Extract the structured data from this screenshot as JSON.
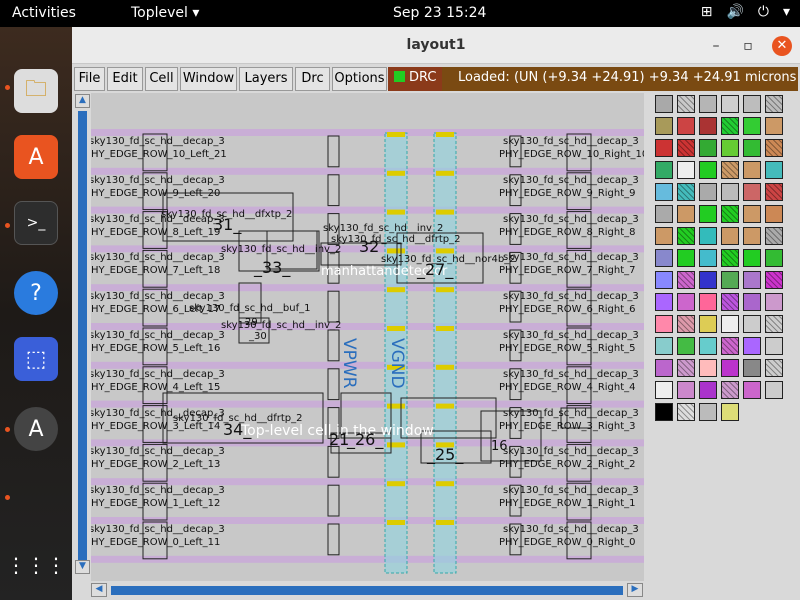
{
  "topbar": {
    "activities": "Activities",
    "app_menu": "Toplevel",
    "clock": "Sep 23  15:24",
    "tray": [
      "network-icon",
      "volume-icon",
      "power-icon",
      "chevron-down-icon"
    ]
  },
  "dock": {
    "apps": [
      {
        "name": "files-icon"
      },
      {
        "name": "software-store-icon"
      },
      {
        "name": "terminal-icon"
      },
      {
        "name": "help-icon"
      },
      {
        "name": "screenshot-icon"
      },
      {
        "name": "updater-icon"
      },
      {
        "name": "show-apps-icon"
      }
    ]
  },
  "window": {
    "title": "layout1",
    "minimize": "–",
    "maximize": "▫",
    "close": "✕"
  },
  "menu": {
    "items": [
      "File",
      "Edit",
      "Cell",
      "Window",
      "Layers",
      "Drc",
      "Options"
    ],
    "drc_label": "DRC",
    "status": "Loaded: (UN     (+9.34 +24.91) +9.34 +24.91 microns"
  },
  "canvas": {
    "rows_left": [
      {
        "cell": "sky130_fd_sc_hd__decap_3",
        "edge": "PHY_EDGE_ROW_10_Left_21"
      },
      {
        "cell": "sky130_fd_sc_hd__decap_3",
        "edge": "PHY_EDGE_ROW_9_Left_20"
      },
      {
        "cell": "sky130_fd_sc_hd__decap_3",
        "edge": "PHY_EDGE_ROW_8_Left_19"
      },
      {
        "cell": "sky130_fd_sc_hd__decap_3",
        "edge": "PHY_EDGE_ROW_7_Left_18"
      },
      {
        "cell": "sky130_fd_sc_hd__decap_3",
        "edge": "PHY_EDGE_ROW_6_Left_17"
      },
      {
        "cell": "sky130_fd_sc_hd__decap_3",
        "edge": "PHY_EDGE_ROW_5_Left_16"
      },
      {
        "cell": "sky130_fd_sc_hd__decap_3",
        "edge": "PHY_EDGE_ROW_4_Left_15"
      },
      {
        "cell": "sky130_fd_sc_hd__decap_3",
        "edge": "PHY_EDGE_ROW_3_Left_14"
      },
      {
        "cell": "sky130_fd_sc_hd__decap_3",
        "edge": "PHY_EDGE_ROW_2_Left_13"
      },
      {
        "cell": "sky130_fd_sc_hd__decap_3",
        "edge": "PHY_EDGE_ROW_1_Left_12"
      },
      {
        "cell": "sky130_fd_sc_hd__decap_3",
        "edge": "PHY_EDGE_ROW_0_Left_11"
      }
    ],
    "rows_right": [
      {
        "cell": "sky130_fd_sc_hd__decap_3",
        "edge": "PHY_EDGE_ROW_10_Right_10"
      },
      {
        "cell": "sky130_fd_sc_hd__decap_3",
        "edge": "PHY_EDGE_ROW_9_Right_9"
      },
      {
        "cell": "sky130_fd_sc_hd__decap_3",
        "edge": "PHY_EDGE_ROW_8_Right_8"
      },
      {
        "cell": "sky130_fd_sc_hd__decap_3",
        "edge": "PHY_EDGE_ROW_7_Right_7"
      },
      {
        "cell": "sky130_fd_sc_hd__decap_3",
        "edge": "PHY_EDGE_ROW_6_Right_6"
      },
      {
        "cell": "sky130_fd_sc_hd__decap_3",
        "edge": "PHY_EDGE_ROW_5_Right_5"
      },
      {
        "cell": "sky130_fd_sc_hd__decap_3",
        "edge": "PHY_EDGE_ROW_4_Right_4"
      },
      {
        "cell": "sky130_fd_sc_hd__decap_3",
        "edge": "PHY_EDGE_ROW_3_Right_3"
      },
      {
        "cell": "sky130_fd_sc_hd__decap_3",
        "edge": "PHY_EDGE_ROW_2_Right_2"
      },
      {
        "cell": "sky130_fd_sc_hd__decap_3",
        "edge": "PHY_EDGE_ROW_1_Right_1"
      },
      {
        "cell": "sky130_fd_sc_hd__decap_3",
        "edge": "PHY_EDGE_ROW_0_Right_0"
      }
    ],
    "cells": {
      "dfxtp": "sky130_fd_sc_hd__dfxtp_2",
      "inv2": "sky130_fd_sc_hd__inv_2",
      "dfrtp": "sky130_fd_sc_hd__dfrtp_2",
      "nor4b": "sky130_fd_sc_hd__nor4b_2",
      "buf1": "sky130_fd_sc_hd__buf_1",
      "inv2b": "sky130_fd_sc_hd__inv_2",
      "dfrtp2": "sky130_fd_sc_hd__dfrtp_2"
    },
    "nums": {
      "n31": "31_",
      "n32": "32",
      "n33": "_33_",
      "n27": "_27_",
      "n29": "29",
      "n30": "_30",
      "n34": "34_",
      "n21": "21",
      "n26": "_26_",
      "n25": "_25_",
      "n16": "16"
    },
    "vpwr": "VPWR",
    "vgnd": "VGND",
    "overlay_top": "manhattandetector",
    "overlay_mid": "Top-level cell in the window"
  },
  "palette_colors": [
    "#a9a9a9",
    "#c9c9c9",
    "#b5b5b5",
    "#cfcfcf",
    "#bdbdbd",
    "#bcbcbc",
    "#a89a5a",
    "#c44",
    "#a33",
    "#2c3",
    "#3c3",
    "#c96",
    "#c33",
    "#c33",
    "#3a3",
    "#6c3",
    "#3b3",
    "#c85",
    "#3a6",
    "#eee",
    "#2c2",
    "#c96",
    "#c96",
    "#4bb",
    "#6bd",
    "#4bb",
    "#aaa",
    "#bbb",
    "#c66",
    "#c44",
    "#aaa",
    "#c96",
    "#2c2",
    "#2c2",
    "#c96",
    "#c85",
    "#c96",
    "#2c2",
    "#3bb",
    "#c96",
    "#c96",
    "#aaa",
    "#88c",
    "#2c2",
    "#4bc",
    "#2c2",
    "#2c2",
    "#3b3",
    "#88f",
    "#c6c",
    "#33c",
    "#5a5",
    "#a7c",
    "#c3c",
    "#a6f",
    "#c6c",
    "#f69",
    "#b5d",
    "#a6c",
    "#c9c",
    "#f8a",
    "#d9a",
    "#dc5",
    "#eee",
    "#ccc",
    "#ccc",
    "#8cc",
    "#4b4",
    "#6cc",
    "#c6c",
    "#a6f",
    "#ccc",
    "#b6c",
    "#c9c",
    "#fbb",
    "#b3c",
    "#888",
    "#ccc",
    "#eee",
    "#c8c",
    "#a3c",
    "#c9c",
    "#c6c",
    "#ccc",
    "#000",
    "#ddd",
    "#bbb",
    "#dd7"
  ]
}
